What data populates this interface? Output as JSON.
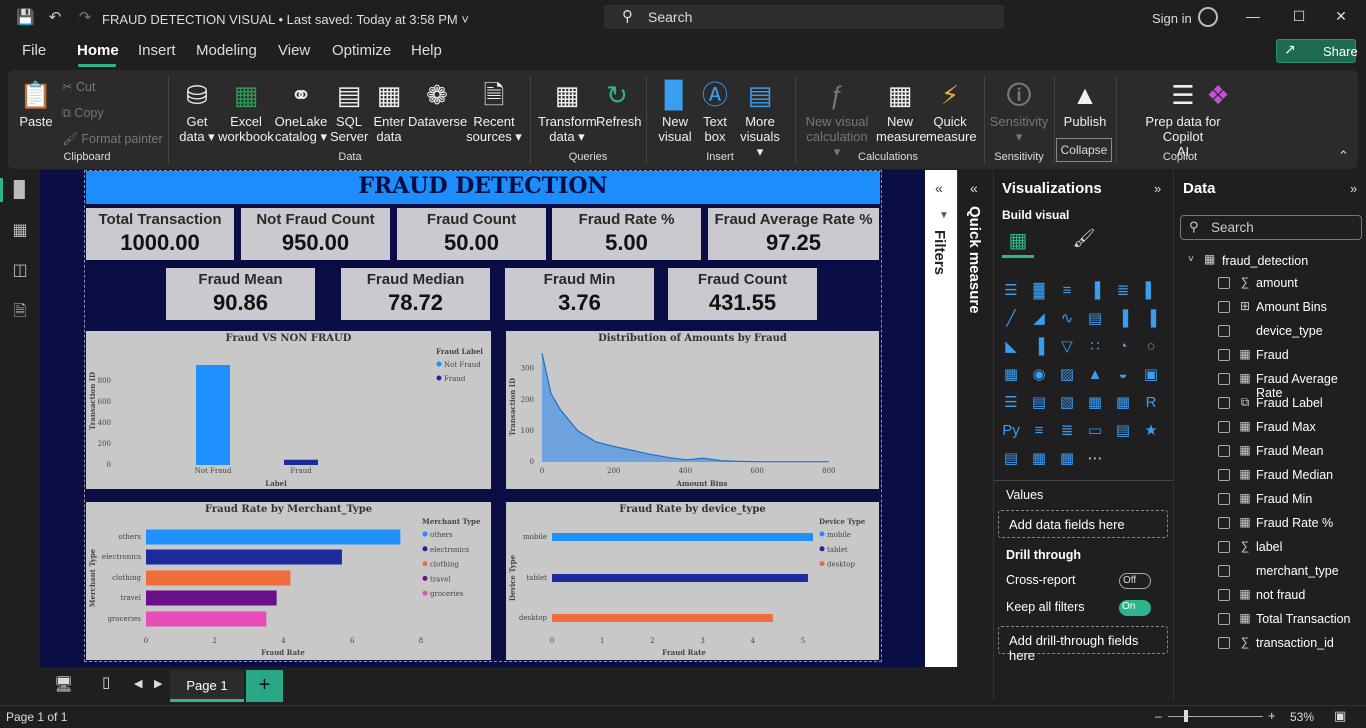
{
  "titlebar": {
    "title": "FRAUD DETECTION VISUAL",
    "saved": "• Last saved: Today at 3:58 PM",
    "search": "Search",
    "signin": "Sign in"
  },
  "menu": {
    "file": "File",
    "home": "Home",
    "insert": "Insert",
    "modeling": "Modeling",
    "view": "View",
    "optimize": "Optimize",
    "help": "Help",
    "share": "Share"
  },
  "ribbon": {
    "paste": "Paste",
    "cut": "Cut",
    "copy": "Copy",
    "format_painter": "Format painter",
    "get_data": [
      "Get",
      "data ▾"
    ],
    "excel": [
      "Excel",
      "workbook"
    ],
    "onelake": [
      "OneLake",
      "catalog ▾"
    ],
    "sql": [
      "SQL",
      "Server"
    ],
    "enter_data": [
      "Enter",
      "data"
    ],
    "dataverse": [
      "Dataverse",
      ""
    ],
    "recent": [
      "Recent",
      "sources ▾"
    ],
    "transform": [
      "Transform",
      "data ▾"
    ],
    "refresh": [
      "Refresh",
      ""
    ],
    "new_visual": [
      "New",
      "visual"
    ],
    "text_box": [
      "Text",
      "box"
    ],
    "more_visuals": [
      "More",
      "visuals ▾"
    ],
    "new_visual_calc": [
      "New visual",
      "calculation ▾"
    ],
    "new_measure": [
      "New",
      "measure"
    ],
    "quick_measure": [
      "Quick",
      "measure"
    ],
    "sensitivity": [
      "Sensitivity",
      "▾"
    ],
    "publish": [
      "Publish",
      ""
    ],
    "prep_data": [
      "Prep data for Copilot",
      "AI"
    ],
    "groups": {
      "clipboard": "Clipboard",
      "data": "Data",
      "queries": "Queries",
      "insert": "Insert",
      "calculations": "Calculations",
      "sensitivity": "Sensitivity",
      "copilot": "Copilot"
    },
    "collapse_tip": "Collapse"
  },
  "report": {
    "title": "FRAUD DETECTION",
    "kpis_row1": [
      {
        "title": "Total Transaction",
        "value": "1000.00"
      },
      {
        "title": "Not Fraud Count",
        "value": "950.00"
      },
      {
        "title": "Fraud Count",
        "value": "50.00"
      },
      {
        "title": "Fraud Rate %",
        "value": "5.00"
      },
      {
        "title": "Fraud Average Rate %",
        "value": "97.25"
      }
    ],
    "kpis_row2": [
      {
        "title": "Fraud Mean",
        "value": "90.86"
      },
      {
        "title": "Fraud Median",
        "value": "78.72"
      },
      {
        "title": "Fraud Min",
        "value": "3.76"
      },
      {
        "title": "Fraud Count",
        "value": "431.55"
      }
    ]
  },
  "chart_data": [
    {
      "type": "bar",
      "title": "Fraud VS NON FRAUD",
      "xlabel": "Label",
      "ylabel": "Transaction ID",
      "categories": [
        "Not Fraud",
        "Fraud"
      ],
      "values": [
        950,
        50
      ],
      "ylim": [
        0,
        950
      ],
      "yticks": [
        "0",
        "200",
        "400",
        "600",
        "800"
      ],
      "legend_title": "Fraud Label",
      "legend": [
        "Not Fraud",
        "Fraud"
      ],
      "colors": [
        "#1e90ff",
        "#1b2a9c"
      ],
      "legend_position": "top-right"
    },
    {
      "type": "area",
      "title": "Distribution of Amounts by Fraud",
      "xlabel": "Amount Bins",
      "ylabel": "Transaction ID",
      "x": [
        0,
        25,
        50,
        100,
        150,
        200,
        250,
        300,
        350,
        400,
        450,
        500,
        550,
        600,
        650,
        700,
        750,
        800
      ],
      "values": [
        350,
        220,
        170,
        100,
        65,
        50,
        38,
        25,
        15,
        7,
        12,
        4,
        2,
        1,
        1,
        1,
        1,
        1
      ],
      "xlim": [
        0,
        820
      ],
      "ylim": [
        0,
        360
      ],
      "xticks": [
        "0",
        "200",
        "400",
        "600",
        "800"
      ],
      "yticks": [
        "0",
        "100",
        "200",
        "300"
      ],
      "color": "#3b8fe6"
    },
    {
      "type": "bar",
      "orientation": "horizontal",
      "title": "Fraud Rate by Merchant_Type",
      "xlabel": "Fraud Rate",
      "ylabel": "Merchant Type",
      "categories": [
        "others",
        "electronics",
        "clothing",
        "travel",
        "groceries"
      ],
      "values": [
        7.4,
        5.7,
        4.2,
        3.8,
        3.5
      ],
      "xlim": [
        0,
        8
      ],
      "xticks": [
        "0",
        "2",
        "4",
        "6",
        "8"
      ],
      "colors": [
        "#1e90ff",
        "#1b2a9c",
        "#ee6d3a",
        "#6a0f8a",
        "#e64bb8"
      ],
      "legend_title": "Merchant Type",
      "legend": [
        "others",
        "electronics",
        "clothing",
        "travel",
        "groceries"
      ],
      "legend_position": "top-right"
    },
    {
      "type": "bar",
      "orientation": "horizontal",
      "title": "Fraud Rate by device_type",
      "xlabel": "Fraud Rate",
      "ylabel": "Device Type",
      "categories": [
        "mobile",
        "tablet",
        "desktop"
      ],
      "values": [
        5.2,
        5.1,
        4.4
      ],
      "xlim": [
        0,
        5.3
      ],
      "xticks": [
        "0",
        "1",
        "2",
        "3",
        "4",
        "5"
      ],
      "colors": [
        "#1e90ff",
        "#1b2a9c",
        "#ee6d3a"
      ],
      "legend_title": "Device Type",
      "legend": [
        "mobile",
        "tablet",
        "desktop"
      ],
      "legend_position": "top-right"
    }
  ],
  "panes": {
    "quick_measure": "Quick measure",
    "filters": "Filters",
    "viz": {
      "title": "Visualizations",
      "build": "Build visual",
      "values": "Values",
      "values_drop": "Add data fields here",
      "drill_through": "Drill through",
      "cross_report": "Cross-report",
      "cross_state": "Off",
      "keep_filters": "Keep all filters",
      "keep_state": "On",
      "drill_drop": "Add drill-through fields here"
    },
    "data": {
      "title": "Data",
      "search_placeholder": "Search",
      "table": "fraud_detection",
      "fields": [
        {
          "icon": "sigma-icon",
          "name": "amount"
        },
        {
          "icon": "bins-icon",
          "name": "Amount Bins"
        },
        {
          "icon": "none",
          "name": "device_type"
        },
        {
          "icon": "calculator-icon",
          "name": "Fraud"
        },
        {
          "icon": "calculator-icon",
          "name": "Fraud Average Rate"
        },
        {
          "icon": "calc-column-icon",
          "name": "Fraud Label"
        },
        {
          "icon": "calculator-icon",
          "name": "Fraud Max"
        },
        {
          "icon": "calculator-icon",
          "name": "Fraud Mean"
        },
        {
          "icon": "calculator-icon",
          "name": "Fraud Median"
        },
        {
          "icon": "calculator-icon",
          "name": "Fraud Min"
        },
        {
          "icon": "calculator-icon",
          "name": "Fraud Rate %"
        },
        {
          "icon": "sigma-icon",
          "name": "label"
        },
        {
          "icon": "none",
          "name": "merchant_type"
        },
        {
          "icon": "calculator-icon",
          "name": "not fraud"
        },
        {
          "icon": "calculator-icon",
          "name": "Total Transaction"
        },
        {
          "icon": "sigma-icon",
          "name": "transaction_id"
        }
      ]
    }
  },
  "bottom": {
    "page_tab": "Page 1",
    "add_page": "+"
  },
  "status": {
    "page": "Page 1 of 1",
    "zoom": "53%"
  }
}
